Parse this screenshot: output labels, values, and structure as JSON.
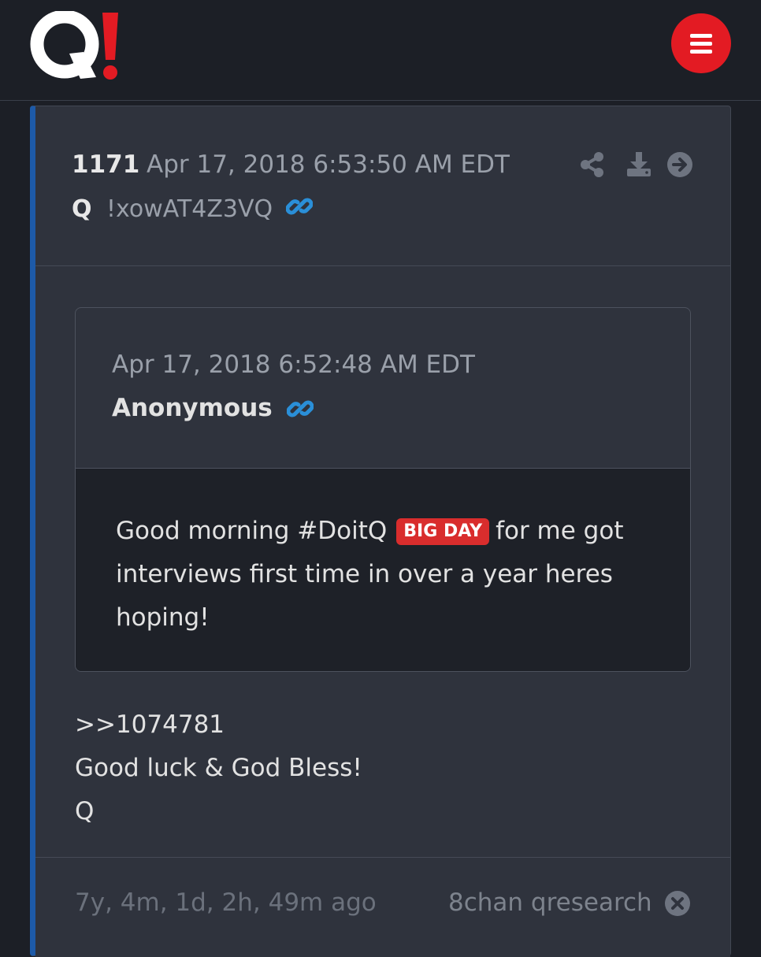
{
  "header": {
    "logo_text": "Q!",
    "menu_icon": "hamburger-menu-icon",
    "brand_color": "#e31b23"
  },
  "post": {
    "number": "1171",
    "date": "Apr 17, 2018 6:53:50 AM EDT",
    "author": "Q",
    "tripcode": "!xowAT4Z3VQ",
    "accent_color": "#1d5aa8",
    "actions": [
      "share-icon",
      "download-icon",
      "arrow-right-circle-icon"
    ],
    "quote": {
      "date": "Apr 17, 2018 6:52:48 AM EDT",
      "author": "Anonymous",
      "body_before": "Good morning #DoitQ",
      "badge": "BIG DAY",
      "body_after": "for me got interviews first time in over a year heres hoping!"
    },
    "reply_lines": [
      ">>1074781",
      "Good luck & God Bless!",
      "Q"
    ],
    "footer": {
      "age": "7y, 4m, 1d, 2h, 49m ago",
      "source": "8chan qresearch"
    }
  }
}
